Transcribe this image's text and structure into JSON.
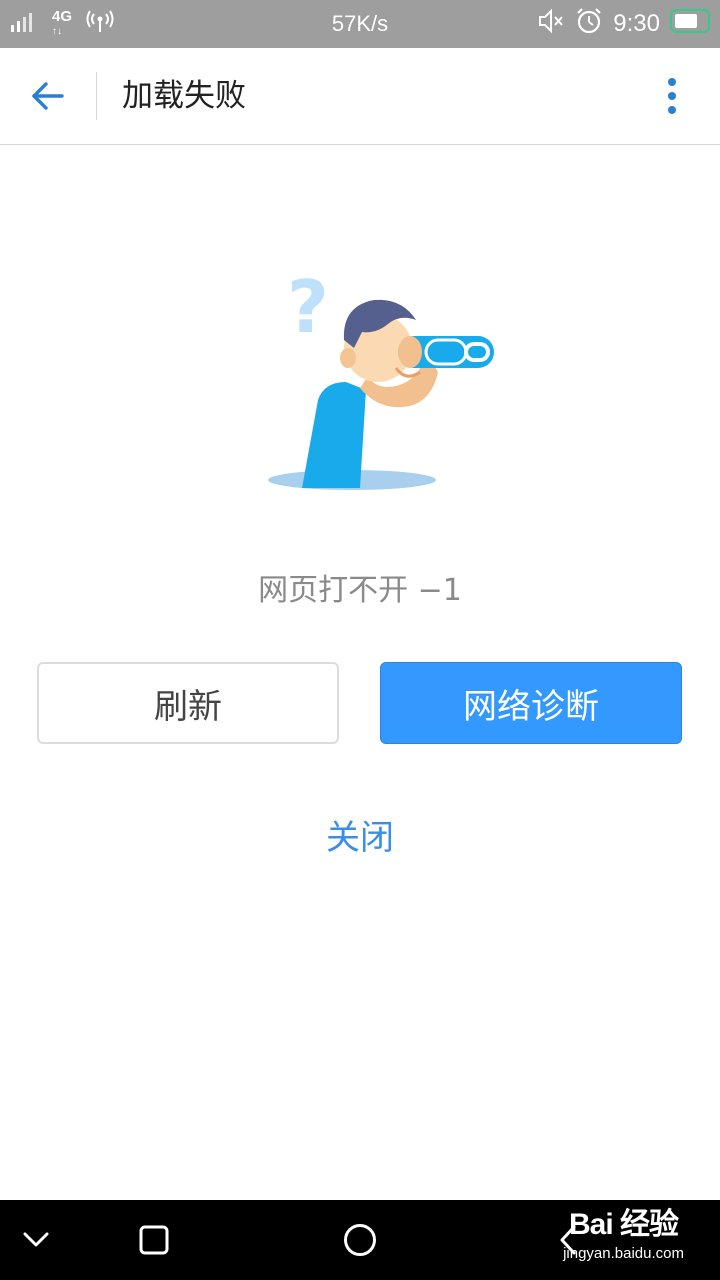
{
  "status_bar": {
    "network_type": "4G",
    "speed": "57K/s",
    "time": "9:30"
  },
  "app_bar": {
    "title": "加载失败"
  },
  "content": {
    "error_message": "网页打不开 −1",
    "refresh_label": "刷新",
    "diagnose_label": "网络诊断",
    "close_label": "关闭"
  },
  "watermark": {
    "main": "Bai 经验",
    "sub": "jingyan.baidu.com"
  },
  "colors": {
    "accent": "#3399ff",
    "link": "#3a8ee6",
    "status_bar": "#9e9e9e",
    "battery": "#35c98a"
  }
}
